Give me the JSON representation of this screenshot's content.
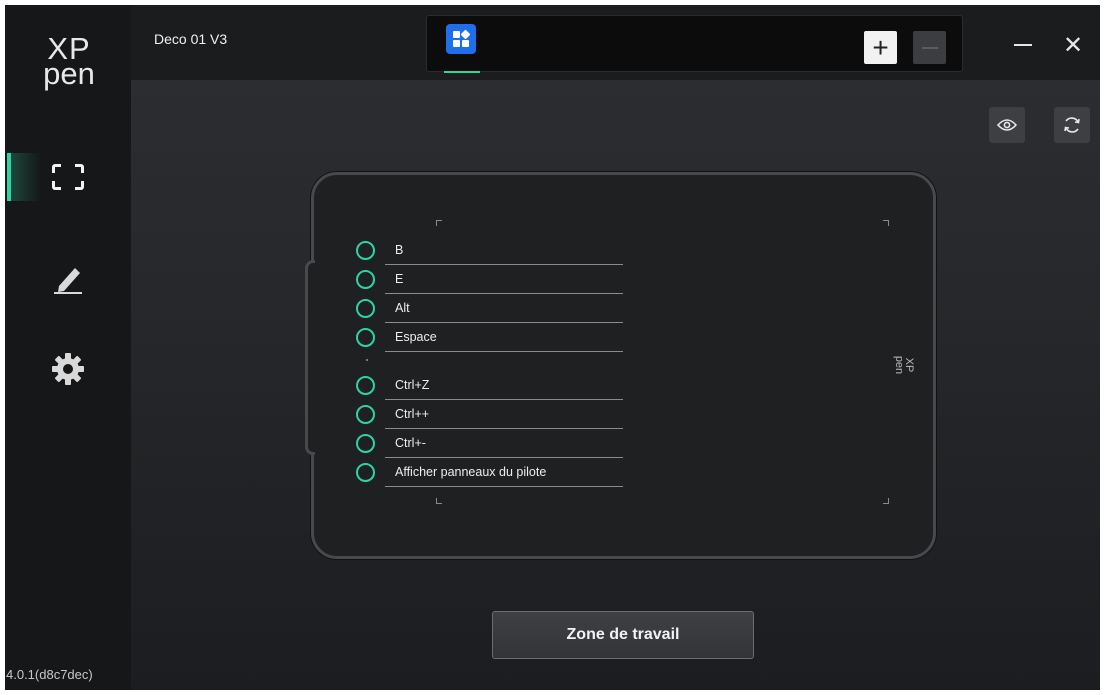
{
  "app": {
    "logo_top": "XP",
    "logo_bottom": "pen",
    "version": "4.0.1(d8c7dec)"
  },
  "topbar": {
    "device_name": "Deco 01 V3",
    "add_label": "+",
    "close_label": "✕"
  },
  "sidebar": {
    "items": [
      {
        "id": "workspace",
        "icon": "frame-corners-icon",
        "active": true
      },
      {
        "id": "pen",
        "icon": "pen-icon",
        "active": false
      },
      {
        "id": "settings",
        "icon": "gear-icon",
        "active": false
      }
    ]
  },
  "tablet": {
    "logo_top": "XP",
    "logo_bottom": "pen",
    "keys": [
      {
        "label": "B"
      },
      {
        "label": "E"
      },
      {
        "label": "Alt"
      },
      {
        "label": "Espace"
      },
      {
        "label": "Ctrl+Z"
      },
      {
        "label": "Ctrl++"
      },
      {
        "label": "Ctrl+-"
      },
      {
        "label": "Afficher panneaux du pilote"
      }
    ]
  },
  "main": {
    "work_area_button": "Zone de travail"
  },
  "colors": {
    "accent": "#2fd2a3",
    "app_tab": "#1f6feb"
  }
}
